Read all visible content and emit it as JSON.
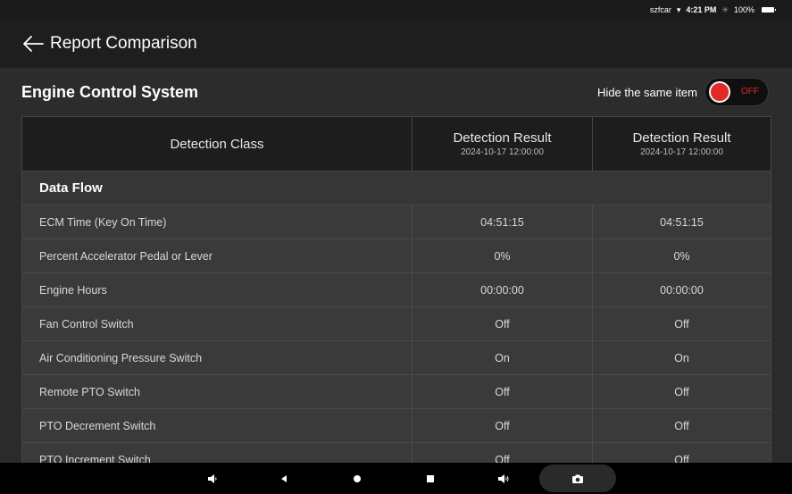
{
  "status_bar": {
    "carrier": "szfcar",
    "time": "4:21 PM",
    "battery": "100%"
  },
  "app_bar": {
    "title": "Report Comparison"
  },
  "section": {
    "title": "Engine Control System",
    "hide_same_label": "Hide the same item",
    "toggle_state": "OFF"
  },
  "table": {
    "header": {
      "class_label": "Detection Class",
      "result_1_label": "Detection Result",
      "result_1_date": "2024-10-17 12:00:00",
      "result_2_label": "Detection Result",
      "result_2_date": "2024-10-17 12:00:00"
    },
    "group": "Data Flow",
    "rows": [
      {
        "name": "ECM Time (Key On Time)",
        "r1": "04:51:15",
        "r2": "04:51:15"
      },
      {
        "name": "Percent Accelerator Pedal or Lever",
        "r1": "0%",
        "r2": "0%"
      },
      {
        "name": "Engine Hours",
        "r1": "00:00:00",
        "r2": "00:00:00"
      },
      {
        "name": "Fan Control Switch",
        "r1": "Off",
        "r2": "Off"
      },
      {
        "name": "Air Conditioning Pressure Switch",
        "r1": "On",
        "r2": "On"
      },
      {
        "name": "Remote PTO Switch",
        "r1": "Off",
        "r2": "Off"
      },
      {
        "name": "PTO Decrement Switch",
        "r1": "Off",
        "r2": "Off"
      },
      {
        "name": "PTO Increment Switch",
        "r1": "Off",
        "r2": "Off"
      }
    ]
  },
  "colors": {
    "toggle_off": "#e02a2a",
    "background": "#2b2b2b"
  }
}
